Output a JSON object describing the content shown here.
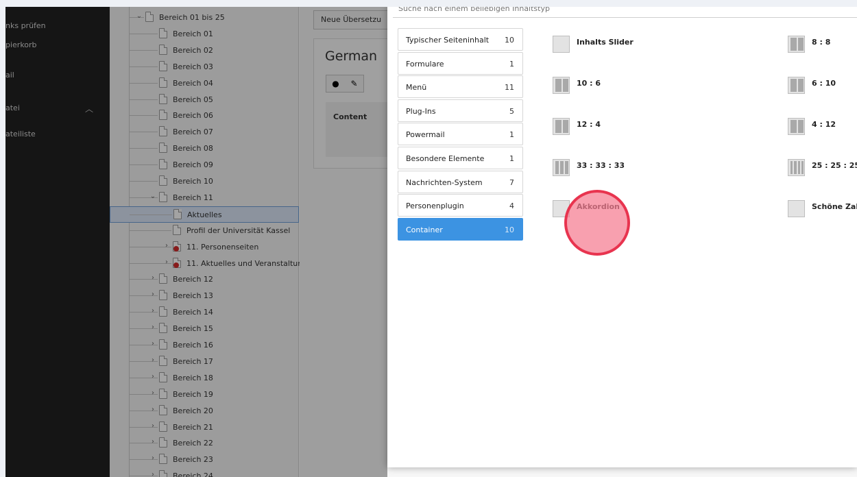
{
  "sidebar": {
    "items": [
      {
        "label": "nks prüfen"
      },
      {
        "label": "pierkorb"
      },
      {
        "label": "ail"
      },
      {
        "label": "atei"
      },
      {
        "label": "ateiliste"
      }
    ],
    "expand_icon": "chevron-up-icon"
  },
  "tree": {
    "rows": [
      {
        "label": "Bereich 01 bis 25",
        "toggle": "expanded",
        "depth": 0
      },
      {
        "label": "Bereich 01",
        "depth": 1
      },
      {
        "label": "Bereich 02",
        "depth": 1
      },
      {
        "label": "Bereich 03",
        "depth": 1
      },
      {
        "label": "Bereich 04",
        "depth": 1
      },
      {
        "label": "Bereich 05",
        "depth": 1
      },
      {
        "label": "Bereich 06",
        "depth": 1
      },
      {
        "label": "Bereich 07",
        "depth": 1
      },
      {
        "label": "Bereich 08",
        "depth": 1
      },
      {
        "label": "Bereich 09",
        "depth": 1
      },
      {
        "label": "Bereich 10",
        "depth": 1
      },
      {
        "label": "Bereich 11",
        "toggle": "expanded",
        "depth": 1
      },
      {
        "label": "Aktuelles",
        "depth": 2,
        "selected": true
      },
      {
        "label": "Profil der Universität Kassel",
        "depth": 2
      },
      {
        "label": "11. Personenseiten",
        "toggle": "collapsed",
        "depth": 2,
        "restricted": true
      },
      {
        "label": "11. Aktuelles und Veranstaltur",
        "toggle": "collapsed",
        "depth": 2,
        "restricted": true
      },
      {
        "label": "Bereich 12",
        "toggle": "collapsed",
        "depth": 1
      },
      {
        "label": "Bereich 13",
        "toggle": "collapsed",
        "depth": 1
      },
      {
        "label": "Bereich 14",
        "toggle": "collapsed",
        "depth": 1
      },
      {
        "label": "Bereich 15",
        "toggle": "collapsed",
        "depth": 1
      },
      {
        "label": "Bereich 16",
        "toggle": "collapsed",
        "depth": 1
      },
      {
        "label": "Bereich 17",
        "toggle": "collapsed",
        "depth": 1
      },
      {
        "label": "Bereich 18",
        "toggle": "collapsed",
        "depth": 1
      },
      {
        "label": "Bereich 19",
        "toggle": "collapsed",
        "depth": 1
      },
      {
        "label": "Bereich 20",
        "toggle": "collapsed",
        "depth": 1
      },
      {
        "label": "Bereich 21",
        "toggle": "collapsed",
        "depth": 1
      },
      {
        "label": "Bereich 22",
        "toggle": "collapsed",
        "depth": 1
      },
      {
        "label": "Bereich 23",
        "toggle": "collapsed",
        "depth": 1
      },
      {
        "label": "Bereich 24",
        "toggle": "collapsed",
        "depth": 1
      }
    ]
  },
  "content": {
    "new_translation_button": "Neue Übersetzu",
    "page_title": "German",
    "content_column_label": "Content"
  },
  "wizard": {
    "search_placeholder": "Suche nach einem beliebigen Inhaltstyp",
    "tabs": [
      {
        "label": "Typischer Seiteninhalt",
        "count": "10"
      },
      {
        "label": "Formulare",
        "count": "1"
      },
      {
        "label": "Menü",
        "count": "11"
      },
      {
        "label": "Plug-Ins",
        "count": "5"
      },
      {
        "label": "Powermail",
        "count": "1"
      },
      {
        "label": "Besondere Elemente",
        "count": "1"
      },
      {
        "label": "Nachrichten-System",
        "count": "7"
      },
      {
        "label": "Personenplugin",
        "count": "4"
      },
      {
        "label": "Container",
        "count": "10",
        "active": true
      }
    ],
    "elements": [
      {
        "label": "Inhalts Slider",
        "icon": "slider-icon",
        "cols": 1
      },
      {
        "label": "8 : 8",
        "icon": "two-columns-icon",
        "cols": 2
      },
      {
        "label": "10 : 6",
        "icon": "two-columns-icon",
        "cols": 2
      },
      {
        "label": "6 : 10",
        "icon": "two-columns-icon",
        "cols": 2
      },
      {
        "label": "12 : 4",
        "icon": "two-columns-icon",
        "cols": 2
      },
      {
        "label": "4 : 12",
        "icon": "two-columns-icon",
        "cols": 2
      },
      {
        "label": "33 : 33 : 33",
        "icon": "three-columns-icon",
        "cols": 3
      },
      {
        "label": "25 : 25 : 25",
        "icon": "four-columns-icon",
        "cols": 4
      },
      {
        "label": "Akkordion",
        "icon": "accordion-icon",
        "cols": 1
      },
      {
        "label": "Schöne Zal",
        "icon": "counter-icon",
        "cols": 1
      }
    ]
  }
}
